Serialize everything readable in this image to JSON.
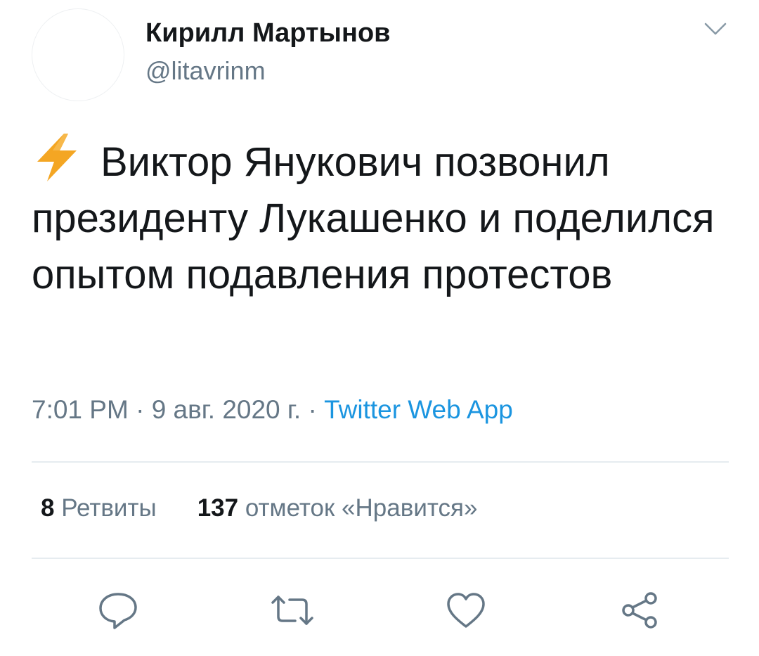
{
  "author": {
    "display_name": "Кирилл Мартынов",
    "handle": "@litavrinm"
  },
  "tweet": {
    "lead_icon": "high-voltage-emoji",
    "text": "Виктор Янукович позвонил президенту Лукашенко и поделился опытом подавления протестов"
  },
  "meta": {
    "time": "7:01 PM",
    "date": "9 авг. 2020 г.",
    "separator": "·",
    "source": "Twitter Web App"
  },
  "stats": {
    "retweets_count": "8",
    "retweets_label": "Ретвиты",
    "likes_count": "137",
    "likes_label": "отметок «Нравится»"
  },
  "actions": [
    "reply-icon",
    "retweet-icon",
    "like-icon",
    "share-icon"
  ],
  "colors": {
    "text": "#14171a",
    "secondary": "#657786",
    "link": "#1b95e0",
    "divider": "#e6ecf0",
    "bolt": "#f4a623"
  }
}
